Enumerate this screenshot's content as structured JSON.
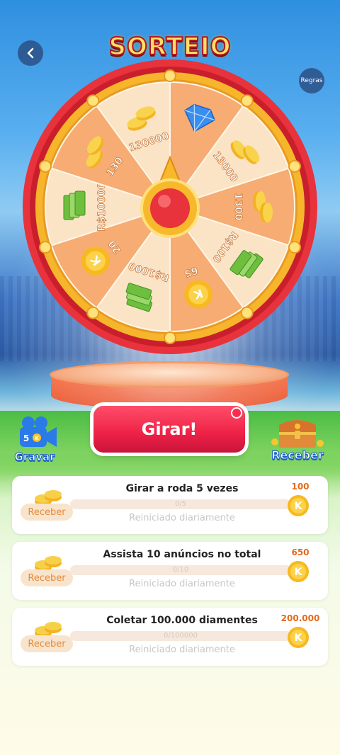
{
  "header": {
    "back_icon": "chevron-left-icon",
    "title": "SORTEIO",
    "rules_label": "Regras"
  },
  "wheel": {
    "segments": [
      {
        "label": "130000",
        "prize": "coin-pile"
      },
      {
        "label": "",
        "prize": "diamond"
      },
      {
        "label": "13000",
        "prize": "coin-pile"
      },
      {
        "label": "1300",
        "prize": "coin-pile"
      },
      {
        "label": "R$100",
        "prize": "cash"
      },
      {
        "label": "65",
        "prize": "k-coin"
      },
      {
        "label": "R$1000",
        "prize": "cash"
      },
      {
        "label": "20",
        "prize": "k-coin"
      },
      {
        "label": "R$10000",
        "prize": "cash"
      },
      {
        "label": "130",
        "prize": "coin-pile"
      }
    ],
    "colors": {
      "segment_light": "#fbe3c6",
      "segment_dark": "#f6ac72",
      "rim_outer": "#e8323c",
      "rim_gold": "#f7b52c",
      "pointer": "#e8323c"
    }
  },
  "actions": {
    "spin_label": "Girar!",
    "record_label": "Gravar",
    "record_count": "5",
    "record_icon": "camera-icon",
    "collect_label": "Receber",
    "collect_icon": "treasure-chest-icon"
  },
  "tasks": [
    {
      "title": "Girar a roda  5  vezes",
      "progress_text": "0/5",
      "progress": 0,
      "reset": "Reiniciado diariamente",
      "reward": "100",
      "claim": "Receber"
    },
    {
      "title": "Assista 10 anúncios no total",
      "progress_text": "0/10",
      "progress": 0,
      "reset": "Reiniciado diariamente",
      "reward": "650",
      "claim": "Receber"
    },
    {
      "title": "Coletar 100.000 diamentes",
      "progress_text": "0/100000",
      "progress": 0,
      "reset": "Reiniciado diariamente",
      "reward": "200.000",
      "claim": "Receber"
    }
  ]
}
